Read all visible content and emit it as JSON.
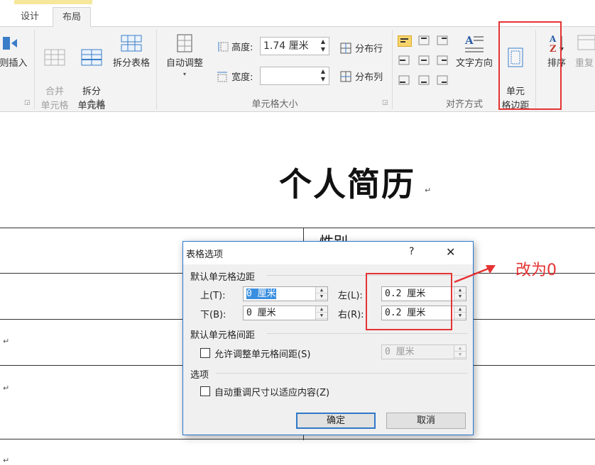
{
  "tabs": [
    {
      "label": "设计"
    },
    {
      "label": "布局"
    }
  ],
  "ribbon": {
    "insert_right_label": "则插入",
    "merge_cells_label": "合并\n单元格",
    "split_cells_label": "拆分\n单元格",
    "split_table_label": "拆分表格",
    "merge_group_label": "合并",
    "autofit_label": "自动调整",
    "height_label": "高度:",
    "height_value": "1.74 厘米",
    "width_label": "宽度:",
    "width_value": "",
    "distribute_rows_label": "分布行",
    "distribute_cols_label": "分布列",
    "cell_size_group_label": "单元格大小",
    "text_direction_label": "文字方向",
    "cell_margins_label": "单元\n格边距",
    "alignment_group_label": "对齐方式",
    "sort_label": "排序",
    "repeat_label": "重复"
  },
  "document": {
    "title": "个人简历",
    "para_mark": "↵",
    "partial_cell_text": "性别"
  },
  "dialog": {
    "title": "表格选项",
    "help": "?",
    "close": "✕",
    "section_margins": "默认单元格边距",
    "top_label": "上(T):",
    "top_value": "0 厘米",
    "bottom_label": "下(B):",
    "bottom_value": "0 厘米",
    "left_label": "左(L):",
    "left_value": "0.2 厘米",
    "right_label": "右(R):",
    "right_value": "0.2 厘米",
    "section_spacing": "默认单元格间距",
    "allow_spacing_label": "允许调整单元格间距(S)",
    "spacing_value": "0 厘米",
    "section_options": "选项",
    "autoresize_label": "自动重调尺寸以适应内容(Z)",
    "ok_label": "确定",
    "cancel_label": "取消"
  },
  "annotation": {
    "text": "改为0",
    "color": "#e53333"
  },
  "colors": {
    "ribbon_bg": "#f3f3f3",
    "dialog_border": "#2b79d1",
    "selected_align": "#f7d46b"
  }
}
